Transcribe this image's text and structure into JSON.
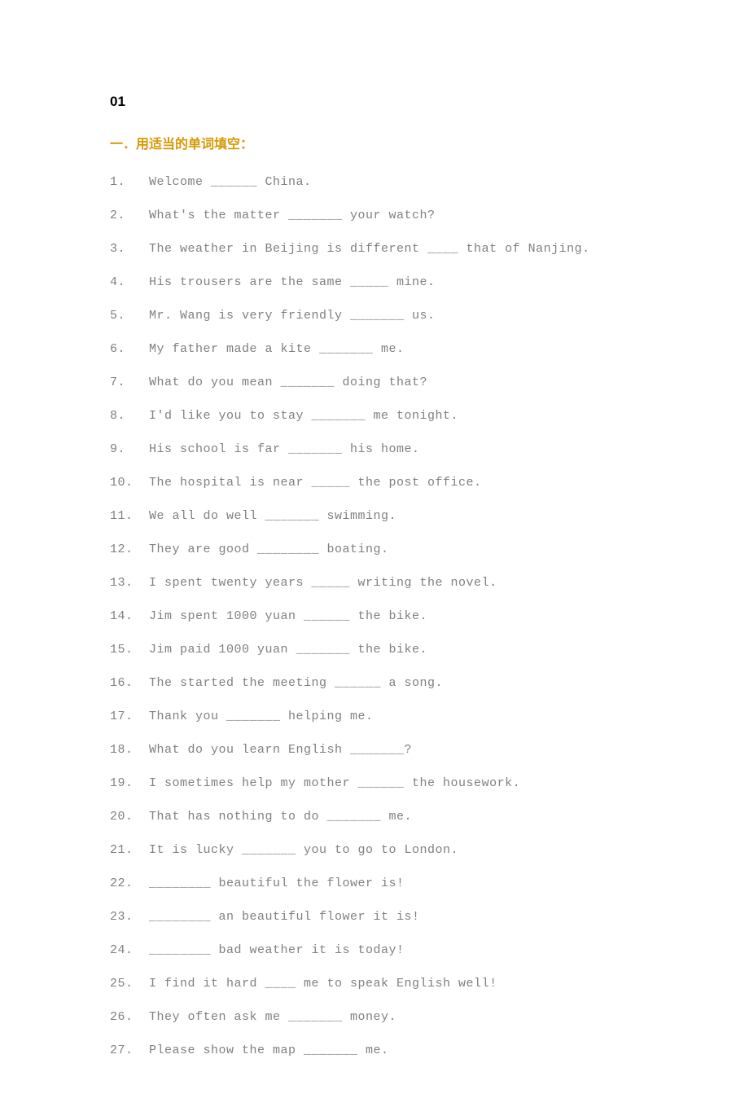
{
  "page_number": "01",
  "section_title": "一．用适当的单词填空：",
  "questions": [
    {
      "num": "1.",
      "text": "Welcome ______ China."
    },
    {
      "num": "2.",
      "text": "What's the matter _______ your watch?"
    },
    {
      "num": "3.",
      "text": "The weather in Beijing is different ____ that of Nanjing."
    },
    {
      "num": "4.",
      "text": "His trousers are the same _____ mine."
    },
    {
      "num": "5.",
      "text": "Mr. Wang is very friendly _______ us."
    },
    {
      "num": "6.",
      "text": "My father made a kite   _______   me."
    },
    {
      "num": "7.",
      "text": "What do you mean _______ doing that?"
    },
    {
      "num": "8.",
      "text": "I'd like you to stay _______ me tonight."
    },
    {
      "num": "9.",
      "text": "His school is far _______ his home."
    },
    {
      "num": "10.",
      "text": "The hospital is near _____ the post office."
    },
    {
      "num": "11.",
      "text": "We all do well _______ swimming."
    },
    {
      "num": "12.",
      "text": "They are good ________ boating."
    },
    {
      "num": "13.",
      "text": "I spent twenty years _____ writing the novel."
    },
    {
      "num": "14.",
      "text": "Jim spent 1000 yuan ______ the bike."
    },
    {
      "num": "15.",
      "text": "Jim paid 1000 yuan _______ the bike."
    },
    {
      "num": "16.",
      "text": "The started the meeting ______ a song."
    },
    {
      "num": "17.",
      "text": "Thank you _______ helping me."
    },
    {
      "num": "18.",
      "text": "What do you learn English _______?"
    },
    {
      "num": "19.",
      "text": "I sometimes help my mother ______ the housework."
    },
    {
      "num": "20.",
      "text": "That has nothing to do _______ me."
    },
    {
      "num": "21.",
      "text": "It is lucky _______ you to go to London."
    },
    {
      "num": "22.",
      "text": "________ beautiful the flower is!"
    },
    {
      "num": "23.",
      "text": "________ an beautiful flower it is!"
    },
    {
      "num": "24.",
      "text": "________ bad weather it is today!"
    },
    {
      "num": "25.",
      "text": "I find it hard ____ me to speak English well!"
    },
    {
      "num": "26.",
      "text": "They often ask me _______ money."
    },
    {
      "num": "27.",
      "text": "Please show the map _______ me."
    }
  ]
}
